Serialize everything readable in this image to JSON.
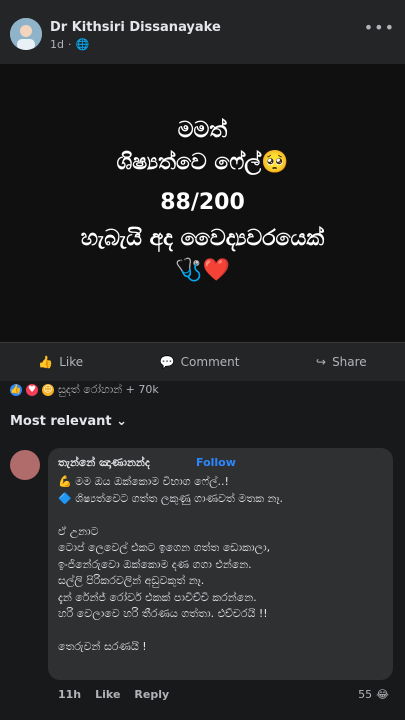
{
  "post": {
    "author": "Dr Kithsiri Dissanayake",
    "time": "1d",
    "more_icon": "more-horizontal-icon",
    "image_text": [
      "මමත්",
      "ශිෂ්‍යත්වෙ ෆේල්🥺",
      "88/200",
      "හැබැයි අද වෛද්‍යවරයෙක්",
      "🩺❤️"
    ]
  },
  "actions": {
    "like": "Like",
    "comment": "Comment",
    "share": "Share"
  },
  "reactions": {
    "summary": "සුදත් රෝහාන් + 70k"
  },
  "filter": {
    "label": "Most relevant"
  },
  "comment": {
    "author": "තැන්නේ ඤාණානන්ද",
    "follow": "Follow",
    "lines": [
      "💪 මම ඔය ඔක්කොම විභාග ෆේල්..!",
      "🔷 ශිෂ්‍යත්වෙට ගත්ත ලකුණු ගාණවත් මතක නෑ.",
      "",
      "ඒ උනාට",
      "ටොප් ලෙවෙල් එකට ඉගෙන ගත්ත ඩොකාලා,",
      "ඉංජිනේරුවො ඔක්කොම දණ ගගා එන්නෙ.",
      "සල්ලි පිරිකරවලින් අඩුවකුත් නෑ.",
      "දැන් රේන්ජ් රෝවර් එකක් පාවිච්චි කරන්නෙ.",
      "හරි වෙලාවෙ හරි තීරණය ගත්තා. එච්චරයි !!",
      "",
      "තෙරුවන් සරණයි !"
    ],
    "time": "11h",
    "like": "Like",
    "reply": "Reply",
    "reaction_count": "55"
  },
  "colors": {
    "accent": "#2d88ff",
    "background": "#18191a"
  }
}
